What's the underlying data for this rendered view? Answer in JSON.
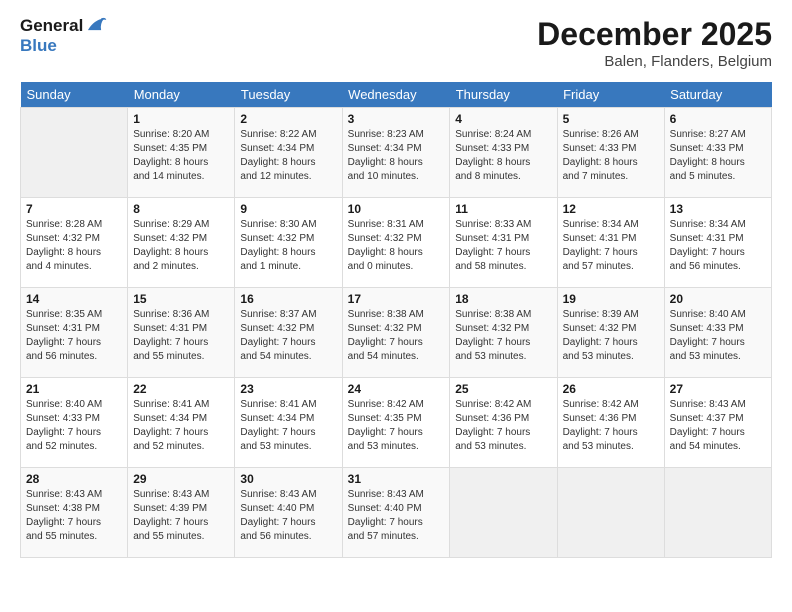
{
  "header": {
    "title": "December 2025",
    "subtitle": "Balen, Flanders, Belgium"
  },
  "days": [
    "Sunday",
    "Monday",
    "Tuesday",
    "Wednesday",
    "Thursday",
    "Friday",
    "Saturday"
  ],
  "weeks": [
    [
      {
        "day": "",
        "info": ""
      },
      {
        "day": "1",
        "info": "Sunrise: 8:20 AM\nSunset: 4:35 PM\nDaylight: 8 hours\nand 14 minutes."
      },
      {
        "day": "2",
        "info": "Sunrise: 8:22 AM\nSunset: 4:34 PM\nDaylight: 8 hours\nand 12 minutes."
      },
      {
        "day": "3",
        "info": "Sunrise: 8:23 AM\nSunset: 4:34 PM\nDaylight: 8 hours\nand 10 minutes."
      },
      {
        "day": "4",
        "info": "Sunrise: 8:24 AM\nSunset: 4:33 PM\nDaylight: 8 hours\nand 8 minutes."
      },
      {
        "day": "5",
        "info": "Sunrise: 8:26 AM\nSunset: 4:33 PM\nDaylight: 8 hours\nand 7 minutes."
      },
      {
        "day": "6",
        "info": "Sunrise: 8:27 AM\nSunset: 4:33 PM\nDaylight: 8 hours\nand 5 minutes."
      }
    ],
    [
      {
        "day": "7",
        "info": "Sunrise: 8:28 AM\nSunset: 4:32 PM\nDaylight: 8 hours\nand 4 minutes."
      },
      {
        "day": "8",
        "info": "Sunrise: 8:29 AM\nSunset: 4:32 PM\nDaylight: 8 hours\nand 2 minutes."
      },
      {
        "day": "9",
        "info": "Sunrise: 8:30 AM\nSunset: 4:32 PM\nDaylight: 8 hours\nand 1 minute."
      },
      {
        "day": "10",
        "info": "Sunrise: 8:31 AM\nSunset: 4:32 PM\nDaylight: 8 hours\nand 0 minutes."
      },
      {
        "day": "11",
        "info": "Sunrise: 8:33 AM\nSunset: 4:31 PM\nDaylight: 7 hours\nand 58 minutes."
      },
      {
        "day": "12",
        "info": "Sunrise: 8:34 AM\nSunset: 4:31 PM\nDaylight: 7 hours\nand 57 minutes."
      },
      {
        "day": "13",
        "info": "Sunrise: 8:34 AM\nSunset: 4:31 PM\nDaylight: 7 hours\nand 56 minutes."
      }
    ],
    [
      {
        "day": "14",
        "info": "Sunrise: 8:35 AM\nSunset: 4:31 PM\nDaylight: 7 hours\nand 56 minutes."
      },
      {
        "day": "15",
        "info": "Sunrise: 8:36 AM\nSunset: 4:31 PM\nDaylight: 7 hours\nand 55 minutes."
      },
      {
        "day": "16",
        "info": "Sunrise: 8:37 AM\nSunset: 4:32 PM\nDaylight: 7 hours\nand 54 minutes."
      },
      {
        "day": "17",
        "info": "Sunrise: 8:38 AM\nSunset: 4:32 PM\nDaylight: 7 hours\nand 54 minutes."
      },
      {
        "day": "18",
        "info": "Sunrise: 8:38 AM\nSunset: 4:32 PM\nDaylight: 7 hours\nand 53 minutes."
      },
      {
        "day": "19",
        "info": "Sunrise: 8:39 AM\nSunset: 4:32 PM\nDaylight: 7 hours\nand 53 minutes."
      },
      {
        "day": "20",
        "info": "Sunrise: 8:40 AM\nSunset: 4:33 PM\nDaylight: 7 hours\nand 53 minutes."
      }
    ],
    [
      {
        "day": "21",
        "info": "Sunrise: 8:40 AM\nSunset: 4:33 PM\nDaylight: 7 hours\nand 52 minutes."
      },
      {
        "day": "22",
        "info": "Sunrise: 8:41 AM\nSunset: 4:34 PM\nDaylight: 7 hours\nand 52 minutes."
      },
      {
        "day": "23",
        "info": "Sunrise: 8:41 AM\nSunset: 4:34 PM\nDaylight: 7 hours\nand 53 minutes."
      },
      {
        "day": "24",
        "info": "Sunrise: 8:42 AM\nSunset: 4:35 PM\nDaylight: 7 hours\nand 53 minutes."
      },
      {
        "day": "25",
        "info": "Sunrise: 8:42 AM\nSunset: 4:36 PM\nDaylight: 7 hours\nand 53 minutes."
      },
      {
        "day": "26",
        "info": "Sunrise: 8:42 AM\nSunset: 4:36 PM\nDaylight: 7 hours\nand 53 minutes."
      },
      {
        "day": "27",
        "info": "Sunrise: 8:43 AM\nSunset: 4:37 PM\nDaylight: 7 hours\nand 54 minutes."
      }
    ],
    [
      {
        "day": "28",
        "info": "Sunrise: 8:43 AM\nSunset: 4:38 PM\nDaylight: 7 hours\nand 55 minutes."
      },
      {
        "day": "29",
        "info": "Sunrise: 8:43 AM\nSunset: 4:39 PM\nDaylight: 7 hours\nand 55 minutes."
      },
      {
        "day": "30",
        "info": "Sunrise: 8:43 AM\nSunset: 4:40 PM\nDaylight: 7 hours\nand 56 minutes."
      },
      {
        "day": "31",
        "info": "Sunrise: 8:43 AM\nSunset: 4:40 PM\nDaylight: 7 hours\nand 57 minutes."
      },
      {
        "day": "",
        "info": ""
      },
      {
        "day": "",
        "info": ""
      },
      {
        "day": "",
        "info": ""
      }
    ]
  ]
}
